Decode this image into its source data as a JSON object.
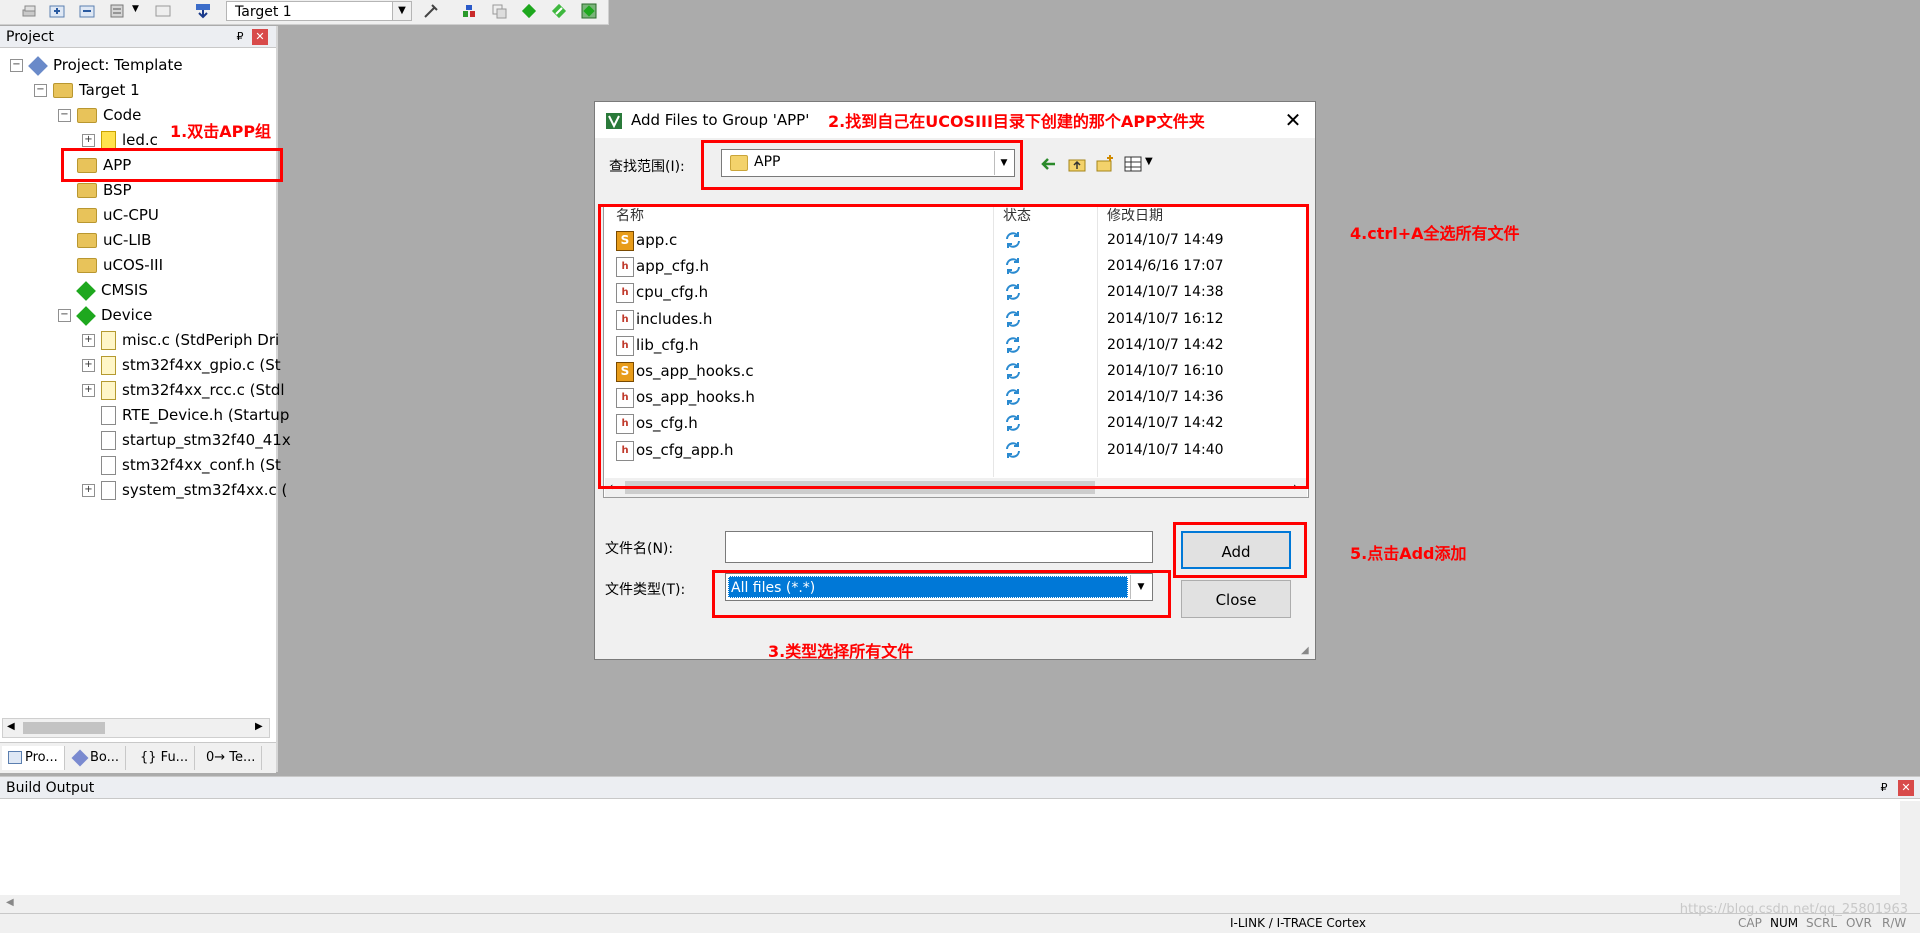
{
  "toolbar": {
    "target_value": "Target 1"
  },
  "project_panel": {
    "title": "Project",
    "pin": "₽",
    "close": "✕",
    "tree": [
      {
        "label": "Project: Template",
        "depth": 0,
        "icon": "project-icon",
        "exp": "−"
      },
      {
        "label": "Target 1",
        "depth": 1,
        "icon": "target-folder-icon",
        "exp": "−"
      },
      {
        "label": "Code",
        "depth": 2,
        "icon": "folder-icon",
        "exp": "−"
      },
      {
        "label": "led.c",
        "depth": 3,
        "icon": "warning-file-icon",
        "exp": "+"
      },
      {
        "label": "APP",
        "depth": 2,
        "icon": "folder-icon",
        "exp": ""
      },
      {
        "label": "BSP",
        "depth": 2,
        "icon": "folder-icon",
        "exp": ""
      },
      {
        "label": "uC-CPU",
        "depth": 2,
        "icon": "folder-icon",
        "exp": ""
      },
      {
        "label": "uC-LIB",
        "depth": 2,
        "icon": "folder-icon",
        "exp": ""
      },
      {
        "label": "uCOS-III",
        "depth": 2,
        "icon": "folder-icon",
        "exp": ""
      },
      {
        "label": "CMSIS",
        "depth": 2,
        "icon": "green-diamond-icon",
        "exp": ""
      },
      {
        "label": "Device",
        "depth": 2,
        "icon": "green-diamond-icon",
        "exp": "−"
      },
      {
        "label": "misc.c (StdPeriph Dri",
        "depth": 3,
        "icon": "key-file-icon",
        "exp": "+"
      },
      {
        "label": "stm32f4xx_gpio.c (St",
        "depth": 3,
        "icon": "key-file-icon",
        "exp": "+"
      },
      {
        "label": "stm32f4xx_rcc.c (Stdl",
        "depth": 3,
        "icon": "key-file-icon",
        "exp": "+"
      },
      {
        "label": "RTE_Device.h (Startup",
        "depth": 3,
        "icon": "file-icon",
        "exp": ""
      },
      {
        "label": "startup_stm32f40_41x",
        "depth": 3,
        "icon": "file-icon",
        "exp": ""
      },
      {
        "label": "stm32f4xx_conf.h (St",
        "depth": 3,
        "icon": "file-icon",
        "exp": ""
      },
      {
        "label": "system_stm32f4xx.c (",
        "depth": 3,
        "icon": "file-icon",
        "exp": "+"
      }
    ],
    "tabs": [
      "Pro...",
      "Bo...",
      "{} Fu...",
      "0→ Te..."
    ]
  },
  "build_output": {
    "title": "Build Output",
    "status_link": "I-LINK / I-TRACE Cortex",
    "status_cap": "CAP",
    "status_num": "NUM",
    "status_scrl": "SCRL",
    "status_ovr": "OVR",
    "status_rw": "R/W"
  },
  "dialog": {
    "title": "Add Files to Group 'APP'",
    "look_in_label": "查找范围(I):",
    "look_in_value": "APP",
    "columns": {
      "name": "名称",
      "status": "状态",
      "date": "修改日期"
    },
    "files": [
      {
        "name": "app.c",
        "type": "c",
        "date": "2014/10/7 14:49"
      },
      {
        "name": "app_cfg.h",
        "type": "h",
        "date": "2014/6/16 17:07"
      },
      {
        "name": "cpu_cfg.h",
        "type": "h",
        "date": "2014/10/7 14:38"
      },
      {
        "name": "includes.h",
        "type": "h",
        "date": "2014/10/7 16:12"
      },
      {
        "name": "lib_cfg.h",
        "type": "h",
        "date": "2014/10/7 14:42"
      },
      {
        "name": "os_app_hooks.c",
        "type": "c",
        "date": "2014/10/7 16:10"
      },
      {
        "name": "os_app_hooks.h",
        "type": "h",
        "date": "2014/10/7 14:36"
      },
      {
        "name": "os_cfg.h",
        "type": "h",
        "date": "2014/10/7 14:42"
      },
      {
        "name": "os_cfg_app.h",
        "type": "h",
        "date": "2014/10/7 14:40"
      }
    ],
    "filename_label": "文件名(N):",
    "filename_value": "",
    "filetype_label": "文件类型(T):",
    "filetype_value": "All files (*.*)",
    "add_label": "Add",
    "close_label": "Close"
  },
  "annotations": {
    "step1": "1.双击APP组",
    "step2": "2.找到自己在UCOSIII目录下创建的那个APP文件夹",
    "step3": "3.类型选择所有文件",
    "step4": "4.ctrl+A全选所有文件",
    "step5": "5.点击Add添加"
  },
  "watermark": "https://blog.csdn.net/qq_25801963",
  "colors": {
    "accent": "#0078d7",
    "annotation": "#ff0000",
    "background": "#ababab"
  }
}
